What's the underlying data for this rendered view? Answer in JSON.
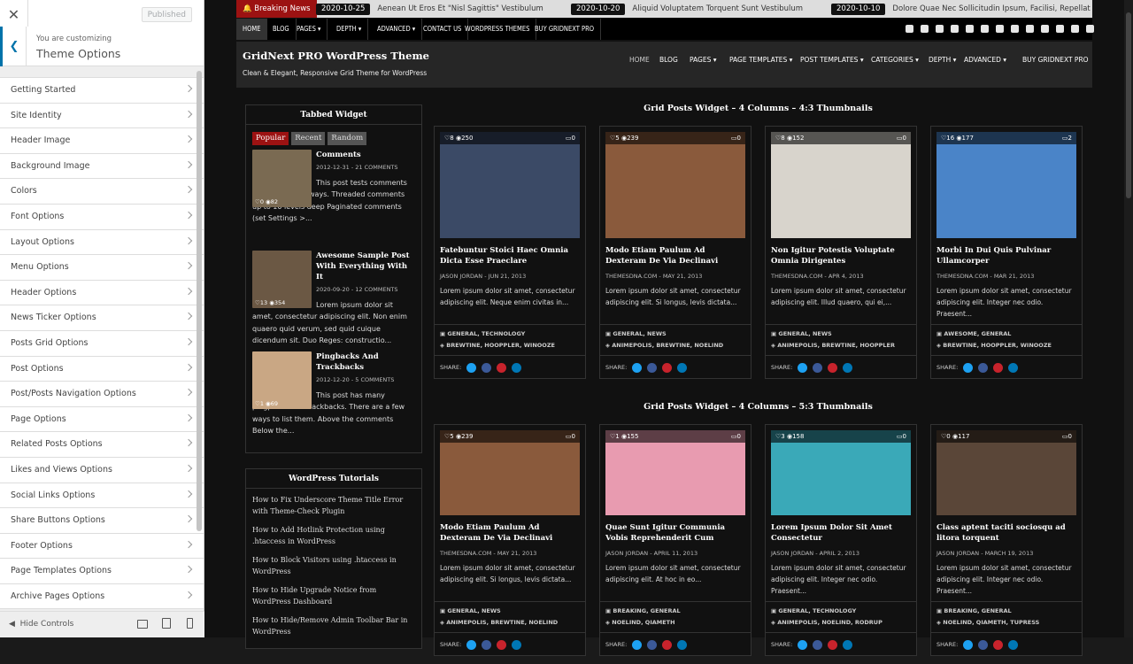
{
  "customizer": {
    "close_icon": "close-icon",
    "published": "Published",
    "sub": "You are customizing",
    "title": "Theme Options",
    "items": [
      "Getting Started",
      "Site Identity",
      "Header Image",
      "Background Image",
      "Colors",
      "Font Options",
      "Layout Options",
      "Menu Options",
      "Header Options",
      "News Ticker Options",
      "Posts Grid Options",
      "Post Options",
      "Post/Posts Navigation Options",
      "Page Options",
      "Related Posts Options",
      "Likes and Views Options",
      "Social Links Options",
      "Share Buttons Options",
      "Footer Options",
      "Page Templates Options",
      "Archive Pages Options"
    ],
    "hide": "Hide Controls"
  },
  "ticker": {
    "label": "Breaking News",
    "items": [
      {
        "date": "2020-10-25",
        "text": "Aenean Ut Eros Et \"Nisl Sagittis\" Vestibulum"
      },
      {
        "date": "2020-10-20",
        "text": "Aliquid Voluptatem Torquent Sunt Vestibulum"
      },
      {
        "date": "2020-10-10",
        "text": "Dolore Quae Nec Sollicitudin Ipsum, Facilisi, Repellat"
      }
    ]
  },
  "topnav": [
    "HOME",
    "BLOG",
    "PAGES ▾",
    "DEPTH ▾",
    "ADVANCED ▾",
    "CONTACT US",
    "WORDPRESS THEMES",
    "BUY GRIDNEXT PRO"
  ],
  "header": {
    "title": "GridNext PRO WordPress Theme",
    "tagline": "Clean & Elegant, Responsive Grid Theme for WordPress",
    "menu": [
      "HOME",
      "BLOG",
      "PAGES ▾",
      "PAGE TEMPLATES ▾",
      "POST TEMPLATES ▾",
      "CATEGORIES ▾",
      "DEPTH ▾",
      "ADVANCED ▾",
      "BUY GRIDNEXT PRO"
    ]
  },
  "tabbed": {
    "title": "Tabbed Widget",
    "tabs": [
      "Popular",
      "Recent",
      "Random"
    ],
    "posts": [
      {
        "title": "Comments",
        "meta": "2012-12-31 - 21 COMMENTS",
        "excerpt": "This post tests comments in the following ways. Threaded comments up to 10 levels deep Paginated comments (set Settings >...",
        "likes": "0",
        "views": "82"
      },
      {
        "title": "Awesome Sample Post With Everything With It",
        "meta": "2020-09-20 - 12 COMMENTS",
        "excerpt": "Lorem ipsum dolor sit amet, consectetur adipiscing elit. Non enim quaero quid verum, sed quid cuique dicendum sit. Duo Reges: constructio...",
        "likes": "13",
        "views": "354"
      },
      {
        "title": "Pingbacks And Trackbacks",
        "meta": "2012-12-20 - 5 COMMENTS",
        "excerpt": "This post has many pingpacks and trackbacks. There are a few ways to list them. Above the comments Below the...",
        "likes": "1",
        "views": "69"
      }
    ]
  },
  "tutorials": {
    "title": "WordPress Tutorials",
    "links": [
      "How to Fix Underscore Theme Title Error with Theme-Check Plugin",
      "How to Add Hotlink Protection using .htaccess in WordPress",
      "How to Block Visitors using .htaccess in WordPress",
      "How to Hide Upgrade Notice from WordPress Dashboard",
      "How to Hide/Remove Admin Toolbar Bar in WordPress"
    ]
  },
  "grid1": {
    "title": "Grid Posts Widget – 4 Columns – 4:3 Thumbnails",
    "cards": [
      {
        "likes": "8",
        "views": "250",
        "comments": "0",
        "title": "Fatebuntur Stoici Haec Omnia Dicta Esse Praeclare",
        "author": "JASON JORDAN",
        "date": "JUN 21, 2013",
        "excerpt": "Lorem ipsum dolor sit amet, consectetur adipiscing elit. Neque enim civitas in...",
        "cats": "GENERAL, TECHNOLOGY",
        "tags": "BREWTINE, HOOPPLER, WINOOZE",
        "color": "#3b4a66"
      },
      {
        "likes": "5",
        "views": "239",
        "comments": "0",
        "title": "Modo Etiam Paulum Ad Dexteram De Via Declinavi",
        "author": "THEMESDNA.COM",
        "date": "MAY 21, 2013",
        "excerpt": "Lorem ipsum dolor sit amet, consectetur adipiscing elit. Si longus, levis dictata...",
        "cats": "GENERAL, NEWS",
        "tags": "ANIMEPOLIS, BREWTINE, NOELIND",
        "color": "#8a5a3c"
      },
      {
        "likes": "8",
        "views": "152",
        "comments": "0",
        "title": "Non Igitur Potestis Voluptate Omnia Dirigentes",
        "author": "THEMESDNA.COM",
        "date": "APR 4, 2013",
        "excerpt": "Lorem ipsum dolor sit amet, consectetur adipiscing elit. Illud quaero, qui ei,...",
        "cats": "GENERAL, NEWS",
        "tags": "ANIMEPOLIS, BREWTINE, HOOPPLER",
        "color": "#d8d4cc"
      },
      {
        "likes": "16",
        "views": "177",
        "comments": "2",
        "title": "Morbi In Dui Quis Pulvinar Ullamcorper",
        "author": "THEMESDNA.COM",
        "date": "MAR 21, 2013",
        "excerpt": "Lorem ipsum dolor sit amet, consectetur adipiscing elit. Integer nec odio. Praesent...",
        "cats": "AWESOME, GENERAL",
        "tags": "BREWTINE, HOOPPLER, WINOOZE",
        "color": "#4a84c8"
      }
    ]
  },
  "grid2": {
    "title": "Grid Posts Widget – 4 Columns – 5:3 Thumbnails",
    "cards": [
      {
        "likes": "5",
        "views": "239",
        "comments": "0",
        "title": "Modo Etiam Paulum Ad Dexteram De Via Declinavi",
        "author": "THEMESDNA.COM",
        "date": "MAY 21, 2013",
        "excerpt": "Lorem ipsum dolor sit amet, consectetur adipiscing elit. Si longus, levis dictata...",
        "cats": "GENERAL, NEWS",
        "tags": "ANIMEPOLIS, BREWTINE, NOELIND",
        "color": "#8a5a3c"
      },
      {
        "likes": "1",
        "views": "155",
        "comments": "0",
        "title": "Quae Sunt Igitur Communia Vobis Reprehenderit Cum",
        "author": "JASON JORDAN",
        "date": "APRIL 11, 2013",
        "excerpt": "Lorem ipsum dolor sit amet, consectetur adipiscing elit. At hoc in eo...",
        "cats": "BREAKING, GENERAL",
        "tags": "NOELIND, QIAMETH",
        "color": "#e89bb0"
      },
      {
        "likes": "3",
        "views": "158",
        "comments": "0",
        "title": "Lorem Ipsum Dolor Sit Amet Consectetur",
        "author": "JASON JORDAN",
        "date": "APRIL 2, 2013",
        "excerpt": "Lorem ipsum dolor sit amet, consectetur adipiscing elit. Integer nec odio. Praesent...",
        "cats": "GENERAL, TECHNOLOGY",
        "tags": "ANIMEPOLIS, NOELIND, RODRUP",
        "color": "#3aa9b8"
      },
      {
        "likes": "0",
        "views": "117",
        "comments": "0",
        "title": "Class aptent taciti sociosqu ad litora torquent",
        "author": "JASON JORDAN",
        "date": "MARCH 19, 2013",
        "excerpt": "Lorem ipsum dolor sit amet, consectetur adipiscing elit. Integer nec odio. Praesent...",
        "cats": "BREAKING, GENERAL",
        "tags": "NOELIND, QIAMETH, TUPRESS",
        "color": "#5a4638"
      }
    ]
  },
  "share_label": "SHARE:"
}
